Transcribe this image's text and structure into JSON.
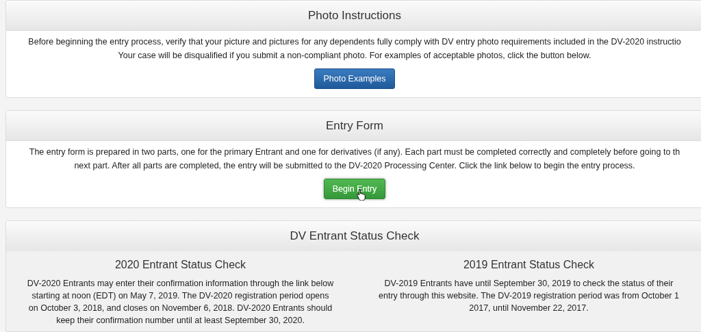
{
  "panels": [
    {
      "title": "Photo Instructions",
      "paragraph_lines": [
        "Before beginning the entry process, verify that your picture and pictures for any dependents fully comply with DV entry photo requirements included in the DV-2020 instructio",
        "Your case will be disqualified if you submit a non-compliant photo.  For examples of acceptable photos, click the button below."
      ],
      "button": {
        "label": "Photo Examples",
        "kind": "primary",
        "hovered": false
      }
    },
    {
      "title": "Entry Form",
      "paragraph_lines": [
        "The entry form is prepared in two parts, one for the primary Entrant and one for derivatives (if any). Each part must be completed correctly and completely before going to th",
        "next part. After all parts are completed, the entry will be submitted to the DV-2020 Processing Center. Click the link below to begin the entry process."
      ],
      "button": {
        "label": "Begin Entry",
        "kind": "success",
        "hovered": true
      }
    }
  ],
  "status_check": {
    "title": "DV Entrant Status Check",
    "columns": [
      {
        "heading": "2020 Entrant Status Check",
        "paragraph_lines": [
          "DV-2020 Entrants may enter their confirmation information through the link below",
          "starting at noon (EDT) on May 7, 2019. The DV-2020 registration period opens",
          "on October 3, 2018, and closes on November 6, 2018. DV-2020 Entrants should",
          "keep their confirmation number until at least September 30, 2020."
        ]
      },
      {
        "heading": "2019 Entrant Status Check",
        "paragraph_lines": [
          "DV-2019 Entrants have until September 30, 2019 to check the status of their",
          "entry through this website. The DV-2019 registration period was from October 1",
          "2017, until November 22, 2017."
        ]
      }
    ]
  }
}
